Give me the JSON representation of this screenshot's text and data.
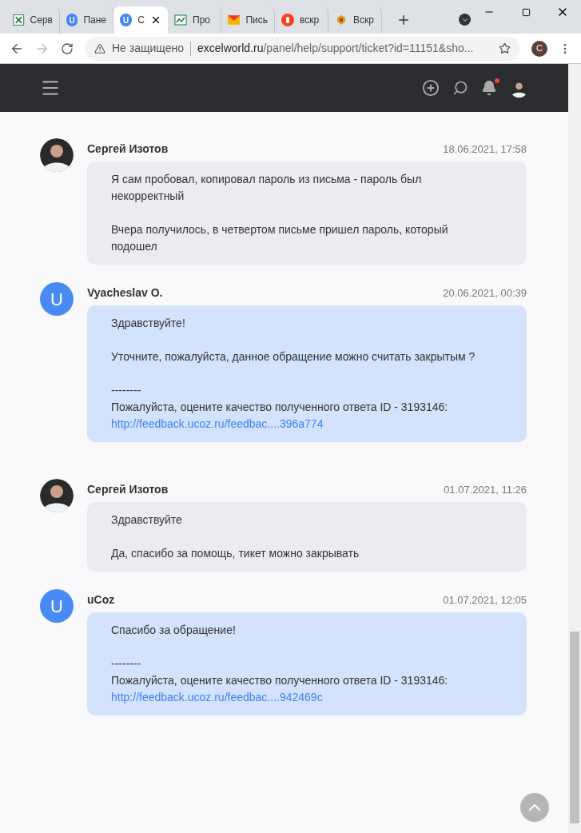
{
  "browser": {
    "tabs": [
      {
        "title": "Серв",
        "kind": "excel",
        "selected": false
      },
      {
        "title": "Пане",
        "kind": "ucoz",
        "favicon_letter": "U",
        "selected": false
      },
      {
        "title": "С",
        "kind": "ucoz",
        "favicon_letter": "U",
        "selected": true
      },
      {
        "title": "Про",
        "kind": "sheet",
        "selected": false
      },
      {
        "title": "Пись",
        "kind": "mail",
        "selected": false
      },
      {
        "title": "вскр",
        "kind": "yandex",
        "selected": false
      },
      {
        "title": "Вскр",
        "kind": "emblem",
        "selected": false
      }
    ],
    "address": {
      "security": "Не защищено",
      "host": "excelworld.ru",
      "path": "/panel/help/support/ticket?id=11151&sho..."
    },
    "profile_initial": "C"
  },
  "header": {
    "notification_dot": true
  },
  "messages": [
    {
      "kind": "user",
      "author": "Сергей Изотов",
      "time": "18.06.2021, 17:58",
      "blocks": [
        [
          {
            "kind": "text",
            "text": "Я сам пробовал, копировал пароль из письма - пароль был некорректный"
          }
        ],
        [
          {
            "kind": "text",
            "text": "Вчера получилось, в четвертом письме пришел пароль, который подошел"
          }
        ]
      ]
    },
    {
      "kind": "support",
      "author": "Vyacheslav O.",
      "avatar_letter": "U",
      "time": "20.06.2021, 00:39",
      "blocks": [
        [
          {
            "kind": "text",
            "text": "Здравствуйте!"
          }
        ],
        [
          {
            "kind": "text",
            "text": "Уточните, пожалуйста, данное обращение можно считать закрытым ?"
          }
        ],
        [
          {
            "kind": "text",
            "text": "--------"
          },
          {
            "kind": "text",
            "text": "Пожалуйста, оцените качество полученного ответа ID - 3193146:"
          },
          {
            "kind": "link",
            "text": "http://feedback.ucoz.ru/feedbac....396a774"
          }
        ]
      ]
    },
    {
      "kind": "user",
      "author": "Сергей Изотов",
      "time": "01.07.2021, 11:26",
      "blocks": [
        [
          {
            "kind": "text",
            "text": "Здравствуйте"
          }
        ],
        [
          {
            "kind": "text",
            "text": "Да, спасибо за помощь, тикет можно закрывать"
          }
        ]
      ]
    },
    {
      "kind": "support",
      "author": "uCoz",
      "avatar_letter": "U",
      "time": "01.07.2021, 12:05",
      "blocks": [
        [
          {
            "kind": "text",
            "text": "Спасибо за обращение!"
          }
        ],
        [
          {
            "kind": "text",
            "text": "--------"
          },
          {
            "kind": "text",
            "text": "Пожалуйста, оцените качество полученного ответа ID - 3193146:"
          },
          {
            "kind": "link",
            "text": "http://feedback.ucoz.ru/feedbac....942469c"
          }
        ]
      ]
    }
  ]
}
